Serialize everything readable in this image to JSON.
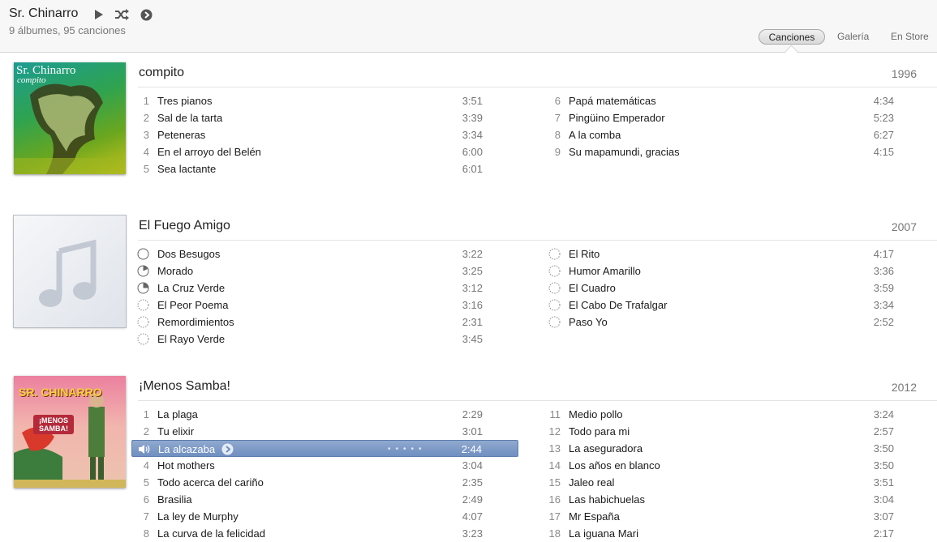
{
  "header": {
    "artist": "Sr. Chinarro",
    "summary": "9 álbumes, 95 canciones",
    "tabs": [
      "Canciones",
      "Galería",
      "En Store"
    ]
  },
  "albums": [
    {
      "title": "compito",
      "year": "1996",
      "cover_text_1": "Sr. Chinarro",
      "cover_text_2": "compito",
      "left": [
        {
          "n": "1",
          "name": "Tres pianos",
          "dur": "3:51"
        },
        {
          "n": "2",
          "name": "Sal de la tarta",
          "dur": "3:39"
        },
        {
          "n": "3",
          "name": "Peteneras",
          "dur": "3:34"
        },
        {
          "n": "4",
          "name": "En el arroyo del Belén",
          "dur": "6:00"
        },
        {
          "n": "5",
          "name": "Sea lactante",
          "dur": "6:01"
        }
      ],
      "right": [
        {
          "n": "6",
          "name": "Papá matemáticas",
          "dur": "4:34"
        },
        {
          "n": "7",
          "name": "Pingüino Emperador",
          "dur": "5:23"
        },
        {
          "n": "8",
          "name": "A la comba",
          "dur": "6:27"
        },
        {
          "n": "9",
          "name": "Su mapamundi, gracias",
          "dur": "4:15"
        }
      ]
    },
    {
      "title": "El Fuego Amigo",
      "year": "2007",
      "left": [
        {
          "icon": "empty",
          "name": "Dos Besugos",
          "dur": "3:22"
        },
        {
          "icon": "quarter",
          "name": "Morado",
          "dur": "3:25"
        },
        {
          "icon": "third",
          "name": "La Cruz Verde",
          "dur": "3:12"
        },
        {
          "icon": "dashed",
          "name": "El Peor Poema",
          "dur": "3:16"
        },
        {
          "icon": "dashed",
          "name": "Remordimientos",
          "dur": "2:31"
        },
        {
          "icon": "dashed",
          "name": "El Rayo Verde",
          "dur": "3:45"
        }
      ],
      "right": [
        {
          "icon": "dashed",
          "name": "El Rito",
          "dur": "4:17"
        },
        {
          "icon": "dashed",
          "name": "Humor Amarillo",
          "dur": "3:36"
        },
        {
          "icon": "dashed",
          "name": "El Cuadro",
          "dur": "3:59"
        },
        {
          "icon": "dashed",
          "name": "El Cabo De Trafalgar",
          "dur": "3:34"
        },
        {
          "icon": "dashed",
          "name": "Paso Yo",
          "dur": "2:52"
        }
      ]
    },
    {
      "title": "¡Menos Samba!",
      "year": "2012",
      "cover_text_1": "SR. CHINARRO",
      "cover_text_2": "¡MENOS SAMBA!",
      "left": [
        {
          "n": "1",
          "name": "La plaga",
          "dur": "2:29"
        },
        {
          "n": "2",
          "name": "Tu elixir",
          "dur": "3:01"
        },
        {
          "n": "",
          "name": "La alcazaba",
          "dur": "2:44",
          "selected": true
        },
        {
          "n": "4",
          "name": "Hot mothers",
          "dur": "3:04"
        },
        {
          "n": "5",
          "name": "Todo acerca del cariño",
          "dur": "2:35"
        },
        {
          "n": "6",
          "name": "Brasilia",
          "dur": "2:49"
        },
        {
          "n": "7",
          "name": "La ley de Murphy",
          "dur": "4:07"
        },
        {
          "n": "8",
          "name": "La curva de la felicidad",
          "dur": "3:23"
        }
      ],
      "right": [
        {
          "n": "11",
          "name": "Medio pollo",
          "dur": "3:24"
        },
        {
          "n": "12",
          "name": "Todo para mi",
          "dur": "2:57"
        },
        {
          "n": "13",
          "name": "La aseguradora",
          "dur": "3:50"
        },
        {
          "n": "14",
          "name": "Los años en blanco",
          "dur": "3:50"
        },
        {
          "n": "15",
          "name": "Jaleo real",
          "dur": "3:51"
        },
        {
          "n": "16",
          "name": "Las habichuelas",
          "dur": "3:04"
        },
        {
          "n": "17",
          "name": "Mr España",
          "dur": "3:07"
        },
        {
          "n": "18",
          "name": "La iguana Mari",
          "dur": "2:17"
        }
      ]
    }
  ]
}
